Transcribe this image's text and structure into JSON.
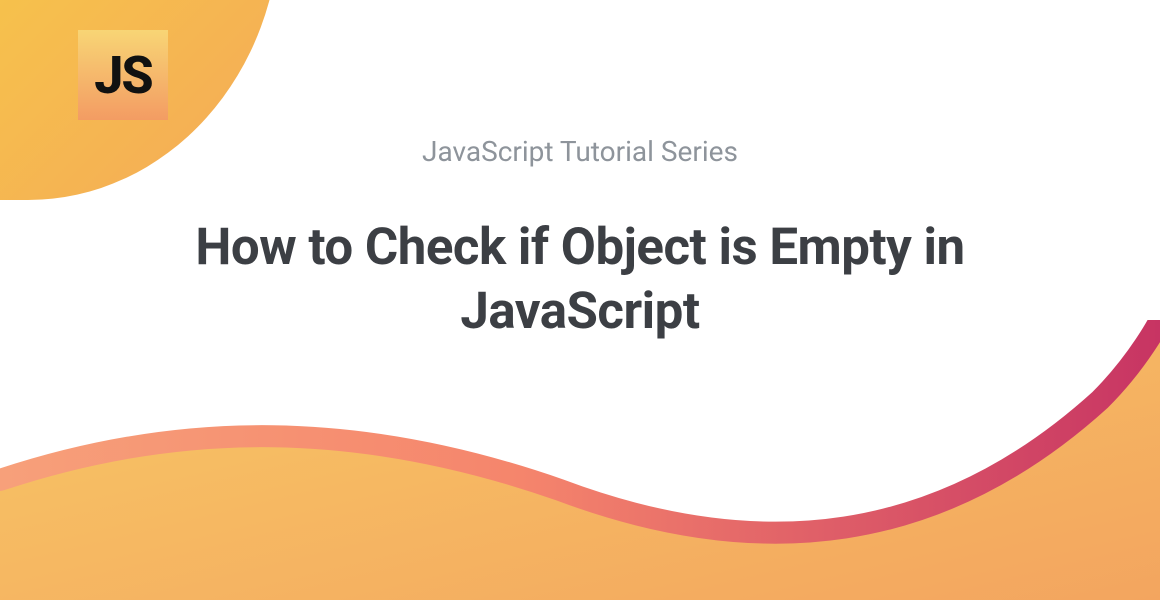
{
  "badge": {
    "text": "JS"
  },
  "subtitle": "JavaScript Tutorial Series",
  "title": "How to Check if Object is Empty in JavaScript"
}
